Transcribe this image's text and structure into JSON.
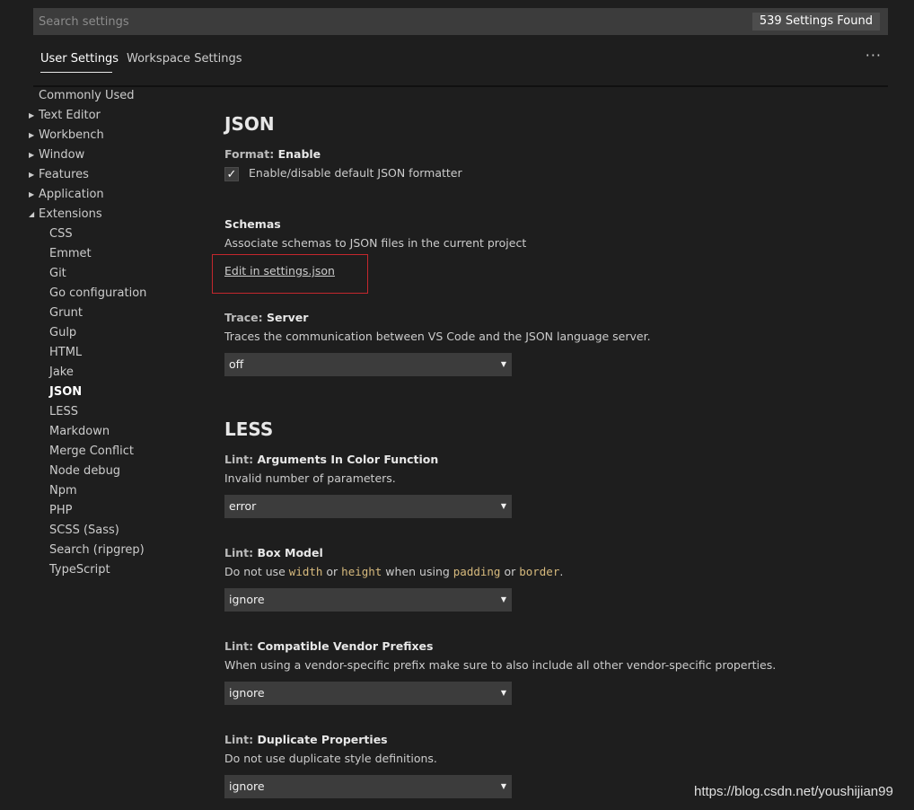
{
  "search": {
    "placeholder": "Search settings",
    "value": "",
    "count": "539 Settings Found"
  },
  "tabs": [
    {
      "label": "User Settings",
      "active": true
    },
    {
      "label": "Workspace Settings",
      "active": false
    }
  ],
  "more_label": "···",
  "toc": {
    "items": [
      {
        "label": "Commonly Used",
        "chevron": ""
      },
      {
        "label": "Text Editor",
        "chevron": "▶"
      },
      {
        "label": "Workbench",
        "chevron": "▶"
      },
      {
        "label": "Window",
        "chevron": "▶"
      },
      {
        "label": "Features",
        "chevron": "▶"
      },
      {
        "label": "Application",
        "chevron": "▶"
      },
      {
        "label": "Extensions",
        "chevron": "◢"
      }
    ],
    "extensions": [
      "CSS",
      "Emmet",
      "Git",
      "Go configuration",
      "Grunt",
      "Gulp",
      "HTML",
      "Jake",
      "JSON",
      "LESS",
      "Markdown",
      "Merge Conflict",
      "Node debug",
      "Npm",
      "PHP",
      "SCSS (Sass)",
      "Search (ripgrep)",
      "TypeScript"
    ],
    "selected": "JSON"
  },
  "json_section": {
    "title": "JSON",
    "format": {
      "category": "Format:",
      "name": "Enable",
      "checkbox_label": "Enable/disable default JSON formatter",
      "checked": true,
      "check_glyph": "✓"
    },
    "schemas": {
      "name": "Schemas",
      "desc": "Associate schemas to JSON files in the current project",
      "link": "Edit in settings.json"
    },
    "trace": {
      "category": "Trace:",
      "name": "Server",
      "desc": "Traces the communication between VS Code and the JSON language server.",
      "value": "off"
    }
  },
  "less_section": {
    "title": "LESS",
    "settings": [
      {
        "category": "Lint:",
        "name": "Arguments In Color Function",
        "desc": "Invalid number of parameters.",
        "value": "error"
      },
      {
        "category": "Lint:",
        "name": "Box Model",
        "desc_parts": [
          "Do not use ",
          "width",
          " or ",
          "height",
          " when using ",
          "padding",
          " or ",
          "border",
          "."
        ],
        "value": "ignore"
      },
      {
        "category": "Lint:",
        "name": "Compatible Vendor Prefixes",
        "desc": "When using a vendor-specific prefix make sure to also include all other vendor-specific properties.",
        "value": "ignore"
      },
      {
        "category": "Lint:",
        "name": "Duplicate Properties",
        "desc": "Do not use duplicate style definitions.",
        "value": "ignore"
      }
    ]
  },
  "dropdown_glyph": "▼",
  "watermark": "https://blog.csdn.net/youshijian99",
  "colors": {
    "background": "#1e1e1e",
    "input": "#3c3c3c",
    "code": "#d7ba7d",
    "highlight": "#c4272d"
  },
  "icons": {
    "checkbox": "check-icon",
    "dropdown": "chevron-down-icon",
    "tree_collapsed": "chevron-right-icon",
    "tree_expanded": "chevron-down-icon",
    "more": "ellipsis-icon"
  }
}
